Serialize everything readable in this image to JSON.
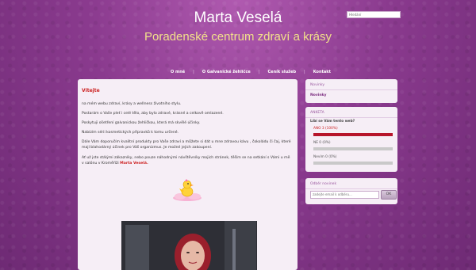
{
  "header": {
    "title": "Marta Veselá",
    "subtitle": "Poradenské centrum zdraví a krásy",
    "search_placeholder": "Hledání"
  },
  "nav": {
    "items": [
      "O mně",
      "O Galvanické žehličce",
      "Ceník služeb",
      "Kontakt"
    ]
  },
  "main": {
    "heading": "Vítejte",
    "paragraphs": [
      "na mém webu zdraví, krásy a wellness životního stylu.",
      "Postarám o Vaše pleť i celé tělo, aby  bylo zdravé, krásné a celkově omlazené.",
      "Poskytuji ošetření galvanickou žehličkou, která má skvělé účinky.",
      "Nabízím sérii kosmetických přípravků k tomu určené.",
      "Dále Vám doporučím kvalitní produkty pro Vaše zdraví a můžete si dát u mne zdravou kávu , čokoládu či čaj, které mají blahodárný účinek pro Váš organizmus. Je možné jejich zakoupení.",
      "Ať už jste stálými zákazníky, nebo pouze náhodnými návštěvníky mojich stránek, těším se na setkání s Vámi u mě v salónu v Kroměříži"
    ],
    "signature": "Marta Veselá."
  },
  "sidebar": {
    "news": {
      "header": "Novinky",
      "link": "Novinky"
    },
    "poll": {
      "header": "ANKETA",
      "question": "Líbí se Vám tento web?",
      "options": [
        {
          "label": "ANO 3 (100%)",
          "percent": 100
        },
        {
          "label": "NE 0 (0%)",
          "percent": 0
        },
        {
          "label": "Nevím 0 (0%)",
          "percent": 0
        }
      ]
    },
    "newsletter": {
      "header": "Odběr novinek",
      "placeholder": "zadejte email k odběru...",
      "button": "OK"
    }
  },
  "colors": {
    "accent_red": "#cc1f1f",
    "poll_bar": "#b7152b",
    "subtitle": "#f2e08a"
  }
}
